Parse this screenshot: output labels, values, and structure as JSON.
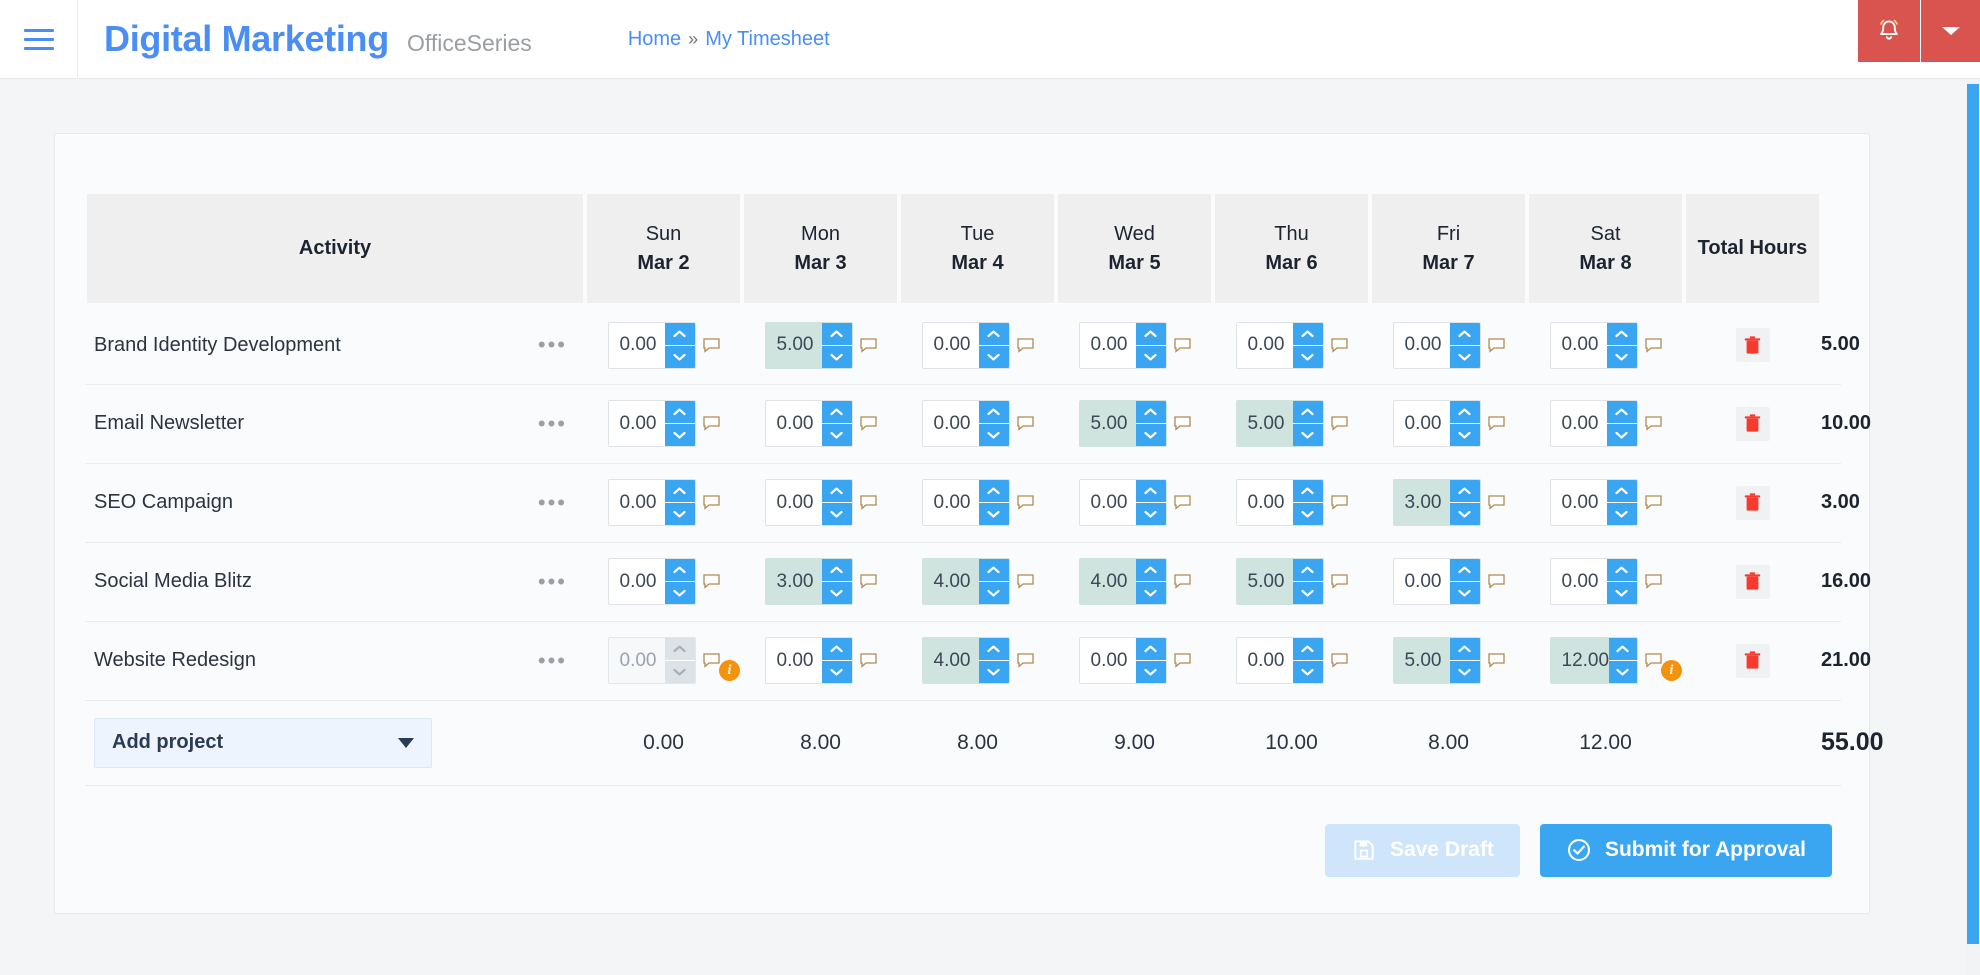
{
  "header": {
    "brand_title": "Digital Marketing",
    "brand_subtitle": "OfficeSeries",
    "breadcrumb_home": "Home",
    "breadcrumb_separator": "»",
    "breadcrumb_current": "My Timesheet"
  },
  "table": {
    "activity_header": "Activity",
    "total_header": "Total Hours",
    "days": [
      {
        "name": "Sun",
        "date": "Mar 2"
      },
      {
        "name": "Mon",
        "date": "Mar 3"
      },
      {
        "name": "Tue",
        "date": "Mar 4"
      },
      {
        "name": "Wed",
        "date": "Mar 5"
      },
      {
        "name": "Thu",
        "date": "Mar 6"
      },
      {
        "name": "Fri",
        "date": "Mar 7"
      },
      {
        "name": "Sat",
        "date": "Mar 8"
      }
    ],
    "rows": [
      {
        "activity": "Brand Identity Development",
        "values": [
          "0.00",
          "5.00",
          "0.00",
          "0.00",
          "0.00",
          "0.00",
          "0.00"
        ],
        "filled": [
          false,
          true,
          false,
          false,
          false,
          false,
          false
        ],
        "disabled": [
          false,
          false,
          false,
          false,
          false,
          false,
          false
        ],
        "warning": [
          false,
          false,
          false,
          false,
          false,
          false,
          false
        ],
        "total": "5.00"
      },
      {
        "activity": "Email Newsletter",
        "values": [
          "0.00",
          "0.00",
          "0.00",
          "5.00",
          "5.00",
          "0.00",
          "0.00"
        ],
        "filled": [
          false,
          false,
          false,
          true,
          true,
          false,
          false
        ],
        "disabled": [
          false,
          false,
          false,
          false,
          false,
          false,
          false
        ],
        "warning": [
          false,
          false,
          false,
          false,
          false,
          false,
          false
        ],
        "total": "10.00"
      },
      {
        "activity": "SEO Campaign",
        "values": [
          "0.00",
          "0.00",
          "0.00",
          "0.00",
          "0.00",
          "3.00",
          "0.00"
        ],
        "filled": [
          false,
          false,
          false,
          false,
          false,
          true,
          false
        ],
        "disabled": [
          false,
          false,
          false,
          false,
          false,
          false,
          false
        ],
        "warning": [
          false,
          false,
          false,
          false,
          false,
          false,
          false
        ],
        "total": "3.00"
      },
      {
        "activity": "Social Media Blitz",
        "values": [
          "0.00",
          "3.00",
          "4.00",
          "4.00",
          "5.00",
          "0.00",
          "0.00"
        ],
        "filled": [
          false,
          true,
          true,
          true,
          true,
          false,
          false
        ],
        "disabled": [
          false,
          false,
          false,
          false,
          false,
          false,
          false
        ],
        "warning": [
          false,
          false,
          false,
          false,
          false,
          false,
          false
        ],
        "total": "16.00"
      },
      {
        "activity": "Website Redesign",
        "values": [
          "0.00",
          "0.00",
          "4.00",
          "0.00",
          "0.00",
          "5.00",
          "12.00"
        ],
        "filled": [
          false,
          false,
          true,
          false,
          false,
          true,
          true
        ],
        "disabled": [
          true,
          false,
          false,
          false,
          false,
          false,
          false
        ],
        "warning": [
          true,
          false,
          false,
          false,
          false,
          false,
          true
        ],
        "total": "21.00"
      }
    ],
    "day_totals": [
      "0.00",
      "8.00",
      "8.00",
      "9.00",
      "10.00",
      "8.00",
      "12.00"
    ],
    "grand_total": "55.00"
  },
  "footer": {
    "add_project_label": "Add project",
    "save_draft_label": "Save Draft",
    "submit_label": "Submit for Approval"
  },
  "icons": {
    "menu": "hamburger-icon",
    "bell": "bell-icon",
    "caret": "chevron-down-icon",
    "note": "comment-icon",
    "trash": "trash-icon",
    "warning": "info-badge-icon",
    "save": "floppy-disk-icon",
    "check": "check-circle-icon"
  },
  "colors": {
    "brand_blue": "#4a8ef5",
    "accent_blue": "#3aa5f0",
    "alert_red": "#d9534f",
    "filled_cell": "#cfe4de",
    "warning_orange": "#f5920b"
  }
}
